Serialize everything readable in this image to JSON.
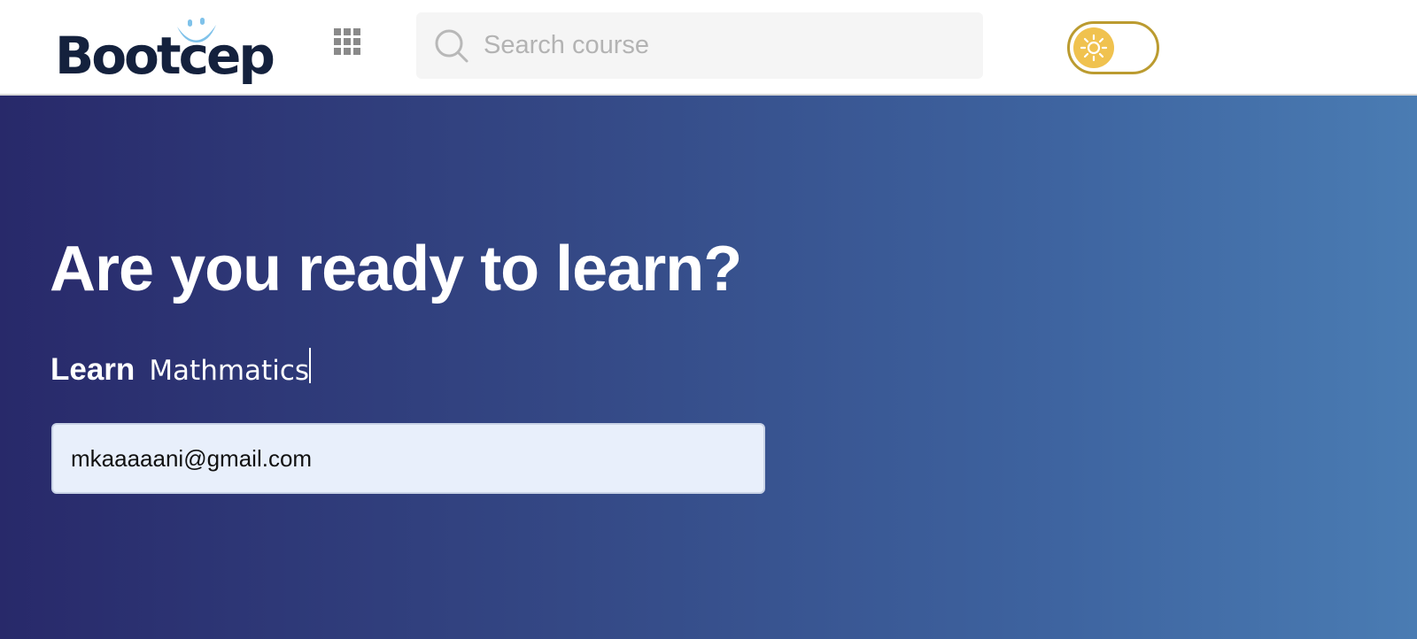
{
  "header": {
    "logo_text": "Bootcep",
    "search": {
      "placeholder": "Search course",
      "value": ""
    },
    "theme_toggle": {
      "state": "light",
      "icon": "sun-icon"
    },
    "apps_icon": "grid-apps-icon"
  },
  "hero": {
    "title": "Are you ready to learn?",
    "learn_label": "Learn",
    "learn_subject": "Mathmatics",
    "email": {
      "value": "mkaaaaani@gmail.com"
    }
  },
  "colors": {
    "accent": "#bb9b30",
    "sun": "#f0c24f",
    "hero_gradient_start": "#28296a",
    "hero_gradient_end": "#4a7cb3",
    "logo_dark": "#14213d",
    "logo_light": "#7fc2ea"
  }
}
